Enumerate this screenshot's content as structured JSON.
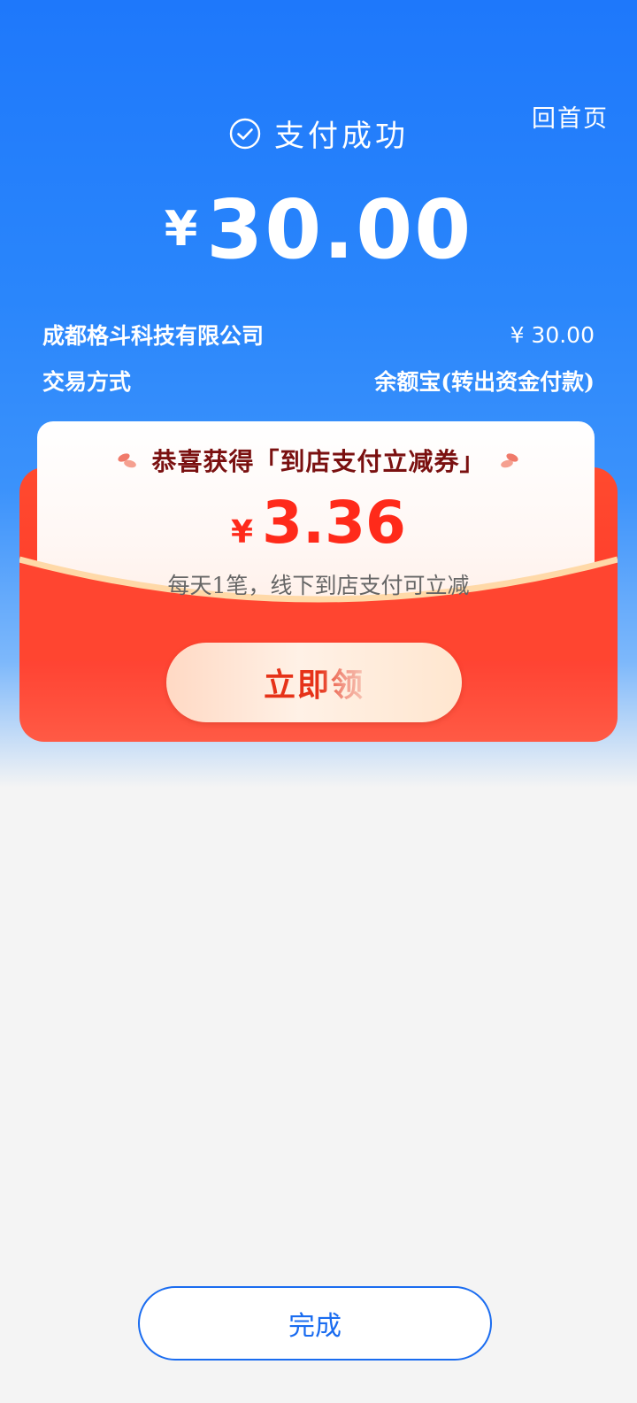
{
  "header": {
    "home_link": "回首页",
    "status_text": "支付成功",
    "currency": "¥",
    "amount": "30.00"
  },
  "details": {
    "merchant_label": "成都格斗科技有限公司",
    "merchant_value": "¥ 30.00",
    "method_label": "交易方式",
    "method_value": "余额宝(转出资金付款)"
  },
  "promo": {
    "title": "恭喜获得「到店支付立减券」",
    "currency": "¥",
    "amount": "3.36",
    "description": "每天1笔，线下到店支付可立减",
    "claim_label": "立即领"
  },
  "footer": {
    "done_label": "完成"
  },
  "colors": {
    "brand_blue": "#1e78fb",
    "promo_red": "#ff3b2c",
    "promo_title": "#7a1010"
  },
  "icons": {
    "status": "check-circle-icon",
    "decor": "petal-icon"
  }
}
